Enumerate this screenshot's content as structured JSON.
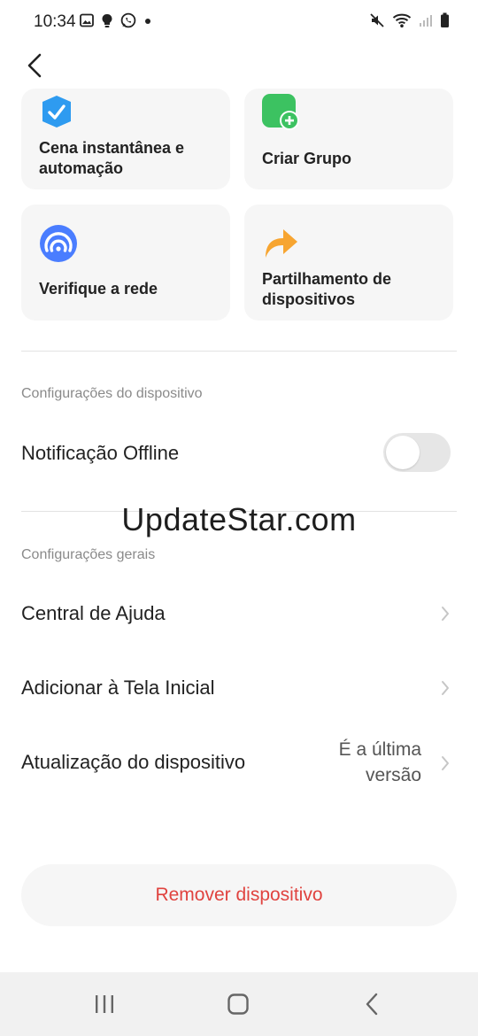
{
  "status_bar": {
    "time": "10:34"
  },
  "quick_actions": [
    {
      "label": "Cena instantânea e\nautomação",
      "icon": "checkmark-shield-icon",
      "color": "#2E9BF0"
    },
    {
      "label": "Criar Grupo",
      "icon": "add-group-icon",
      "color": "#3CC261"
    },
    {
      "label": "Verifique a rede",
      "icon": "network-signal-icon",
      "color": "#4A7DFF"
    },
    {
      "label": "Partilhamento de\ndispositivos",
      "icon": "share-arrow-icon",
      "color": "#F7A531"
    }
  ],
  "device_settings": {
    "title": "Configurações do dispositivo",
    "offline_notification": {
      "label": "Notificação Offline",
      "enabled": false
    }
  },
  "watermark": "UpdateStar.com",
  "general_settings": {
    "title": "Configurações gerais",
    "items": [
      {
        "label": "Central de Ajuda",
        "value": ""
      },
      {
        "label": "Adicionar à Tela Inicial",
        "value": ""
      },
      {
        "label": "Atualização do dispositivo",
        "value": "É a última\nversão"
      }
    ]
  },
  "remove_button": {
    "label": "Remover dispositivo",
    "color": "#E0433F"
  }
}
